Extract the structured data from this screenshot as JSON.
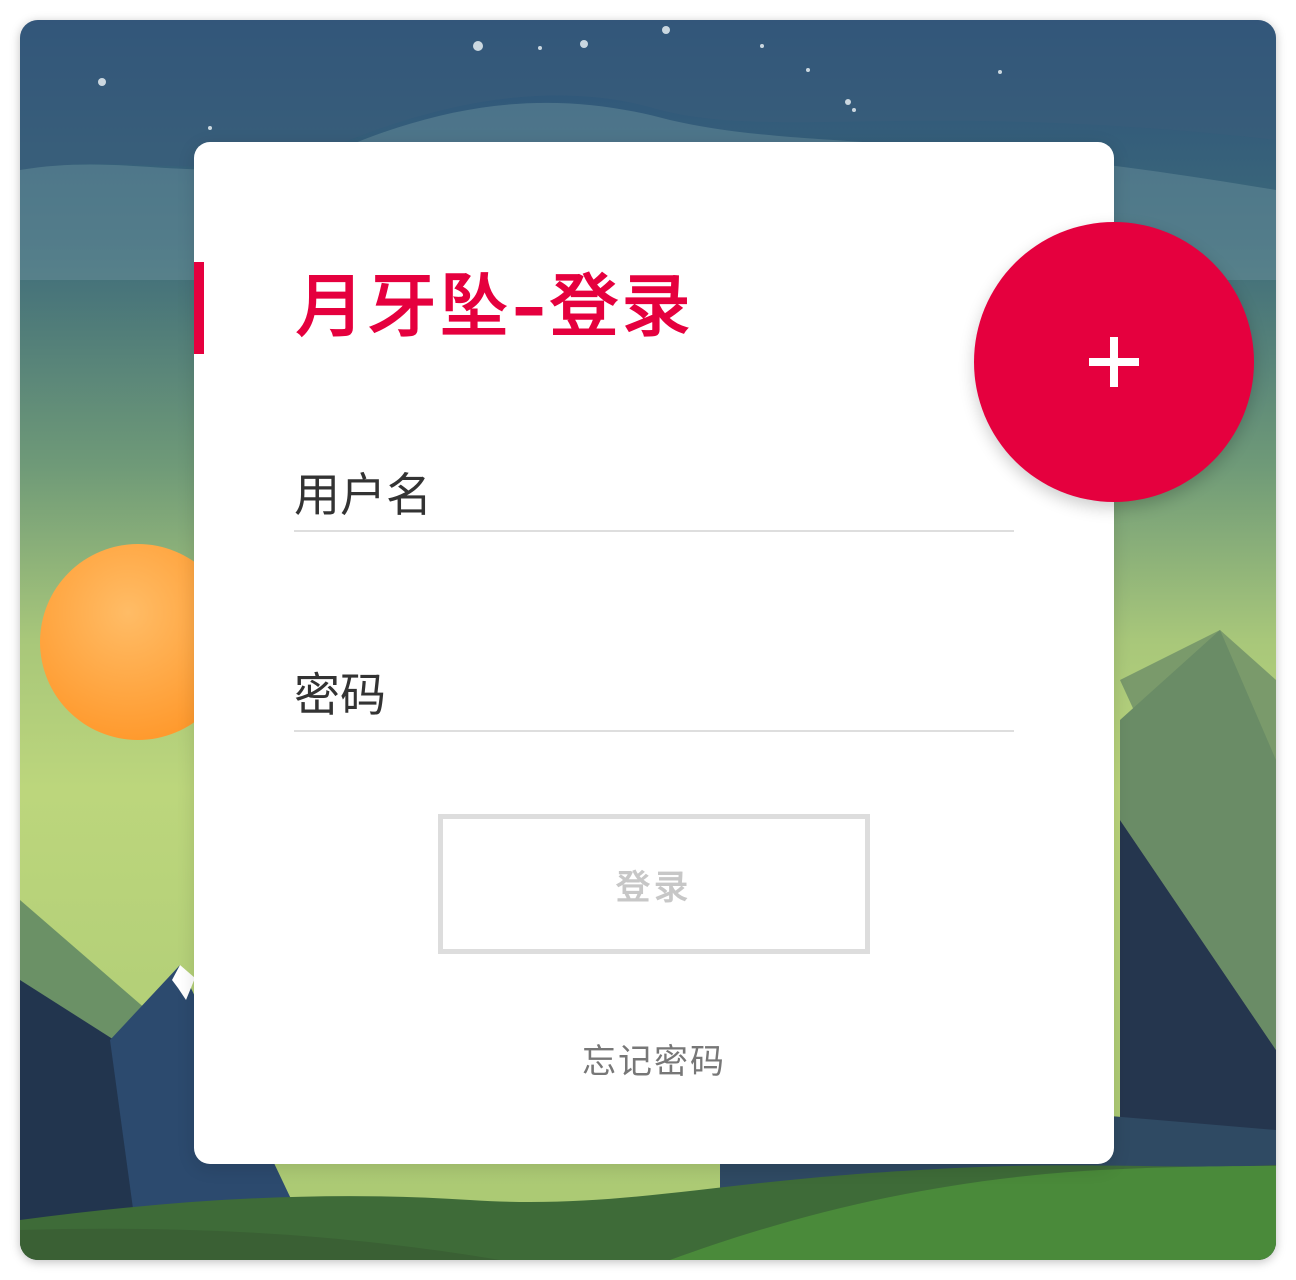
{
  "title": "月牙坠–登录",
  "form": {
    "username_placeholder": "用户名",
    "password_placeholder": "密码",
    "username_value": "",
    "password_value": ""
  },
  "login_button_label": "登录",
  "forgot_password_label": "忘记密码",
  "fab_icon": "plus-icon",
  "colors": {
    "accent": "#e5003e",
    "card": "#ffffff",
    "field_line": "#dedede",
    "button_border": "#dddddd",
    "button_text": "#c7c7c7",
    "link_text": "#777777"
  }
}
